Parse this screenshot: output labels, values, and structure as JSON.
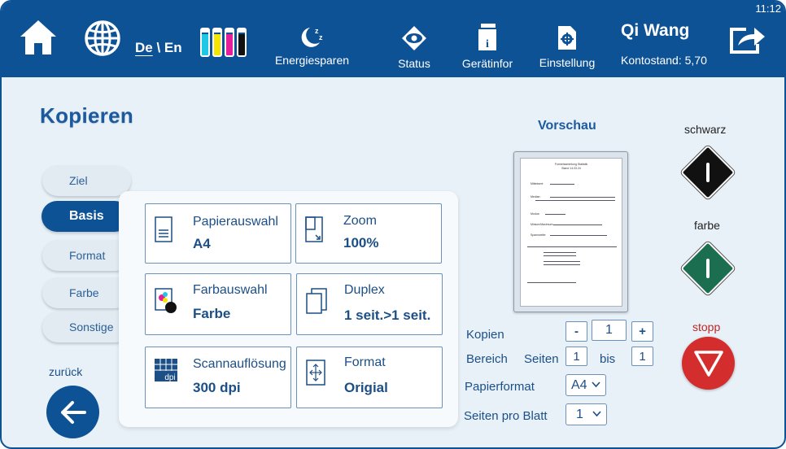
{
  "topbar": {
    "time": "11:12",
    "language": {
      "de": "De",
      "separator": " \\ ",
      "en": "En"
    },
    "ink_colors": [
      "#1ec7e6",
      "#f4e600",
      "#e61e9a",
      "#111111"
    ],
    "energy_label": "Energiesparen",
    "status_label": "Status",
    "device_info_label": "Gerätinfor",
    "settings_label": "Einstellung",
    "user_name": "Qi Wang",
    "balance": "Kontostand:  5,70"
  },
  "page_title": "Kopieren",
  "side_tabs": [
    "Ziel",
    "Basis",
    "Format",
    "Farbe",
    "Sonstige"
  ],
  "active_tab": "Basis",
  "tiles": {
    "paper": {
      "name": "Papierauswahl",
      "value": "A4"
    },
    "zoom": {
      "name": "Zoom",
      "value": "100%"
    },
    "color": {
      "name": "Farbauswahl",
      "value": "Farbe"
    },
    "duplex": {
      "name": "Duplex",
      "value": "1 seit.>1 seit."
    },
    "scan": {
      "name": "Scannauflösung",
      "value": "300 dpi",
      "icon_text": "dpi"
    },
    "format": {
      "name": "Format",
      "value": "Origial"
    }
  },
  "back_label": "zurück",
  "preview": {
    "title": "Vorschau",
    "doc_title": "Formelsammlung Statistik",
    "doc_date": "Stand 14.03.24",
    "bullets": [
      "Mittelwert:",
      "Median:",
      "Modus:",
      "Minium/Maximum:",
      "Spannweite:"
    ]
  },
  "options": {
    "copies_label": "Kopien",
    "copies_minus": "-",
    "copies_value": "1",
    "copies_plus": "+",
    "range_label": "Bereich",
    "pages_label": "Seiten",
    "range_from": "1",
    "range_to_label": "bis",
    "range_to": "1",
    "paper_format_label": "Papierformat",
    "paper_format_value": "A4",
    "pages_per_sheet_label": "Seiten pro Blatt",
    "pages_per_sheet_value": "1"
  },
  "actions": {
    "black_label": "schwarz",
    "color_label": "farbe",
    "stop_label": "stopp",
    "black_color": "#111111",
    "color_color": "#1b6e4f",
    "stop_color": "#d42d2d"
  }
}
